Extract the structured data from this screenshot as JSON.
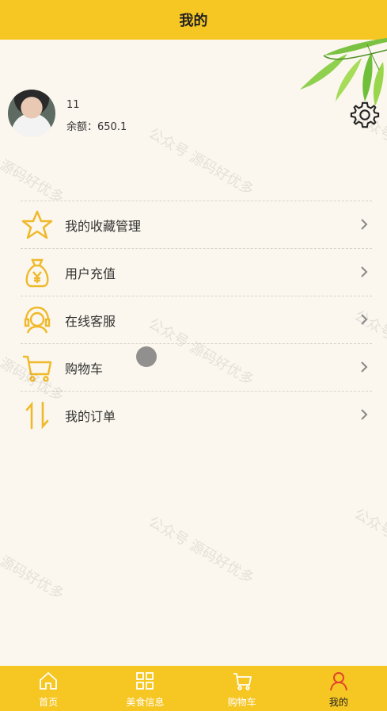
{
  "header": {
    "title": "我的"
  },
  "profile": {
    "user_name": "11",
    "balance_label": "余额：650.1"
  },
  "menu": {
    "items": [
      {
        "label": "我的收藏管理",
        "icon": "star-icon"
      },
      {
        "label": "用户充值",
        "icon": "money-bag-icon"
      },
      {
        "label": "在线客服",
        "icon": "headset-icon"
      },
      {
        "label": "购物车",
        "icon": "cart-icon"
      },
      {
        "label": "我的订单",
        "icon": "sort-arrows-icon"
      }
    ]
  },
  "tabbar": {
    "tabs": [
      {
        "label": "首页",
        "icon": "home-icon"
      },
      {
        "label": "美食信息",
        "icon": "grid-icon"
      },
      {
        "label": "购物车",
        "icon": "cart-icon"
      },
      {
        "label": "我的",
        "icon": "user-icon"
      }
    ],
    "active_index": 3
  },
  "watermark": {
    "text": "公众号 源码好优多"
  },
  "colors": {
    "accent": "#f6c623",
    "icon": "#f0b92b",
    "background": "#fbf7ee",
    "active_tab_icon": "#e0452a"
  }
}
